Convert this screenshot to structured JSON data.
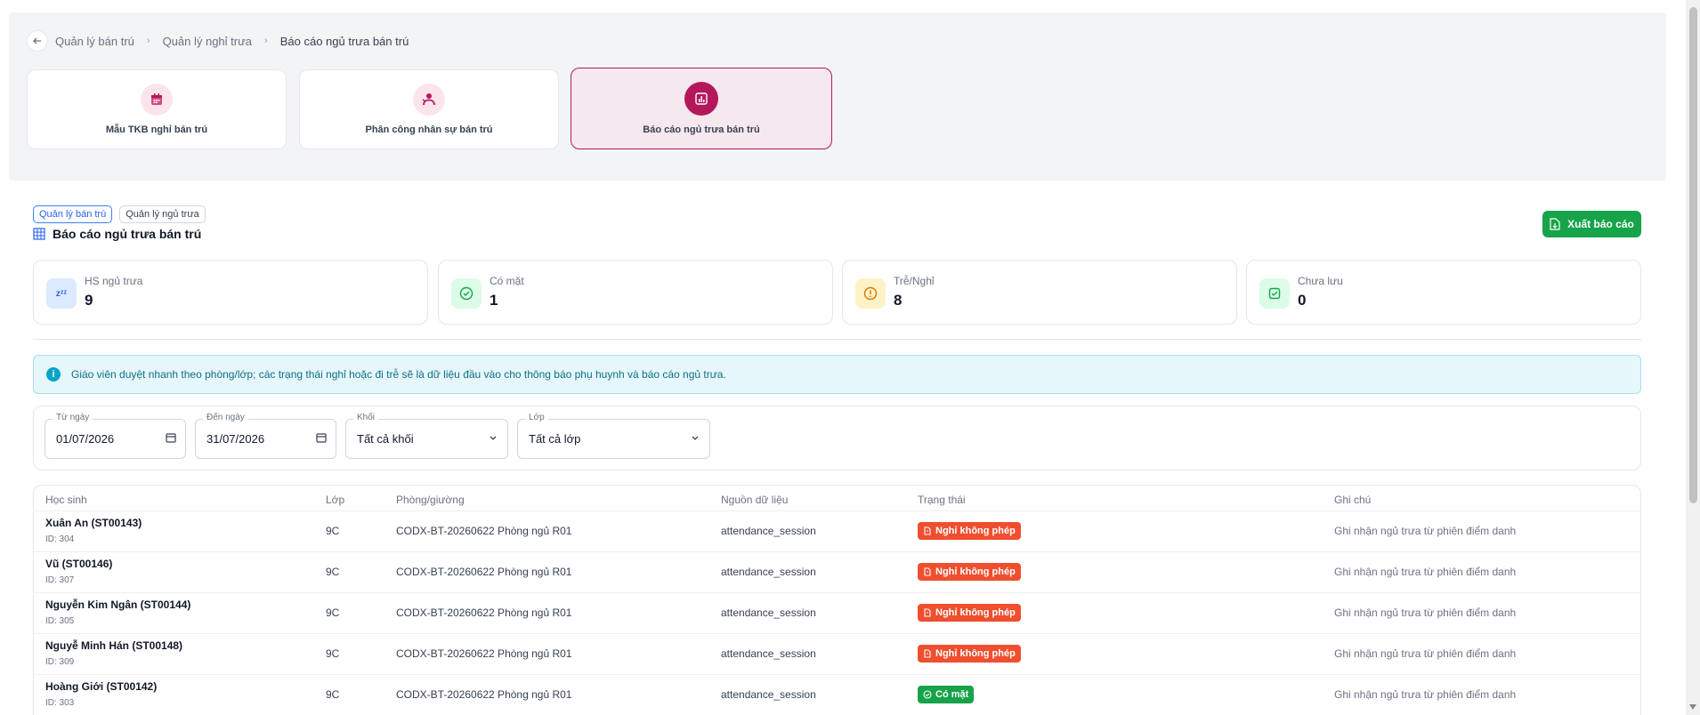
{
  "breadcrumb": {
    "items": [
      "Quản lý bán trú",
      "Quản lý nghỉ trưa",
      "Báo cáo ngủ trưa bán trú"
    ]
  },
  "nav_cards": [
    {
      "label": "Mẫu TKB nghỉ bán trú",
      "icon": "calendar-icon"
    },
    {
      "label": "Phân công nhân sự bán trú",
      "icon": "staff-assign-icon"
    },
    {
      "label": "Báo cáo ngủ trưa bán trú",
      "icon": "report-chart-icon",
      "active": true
    }
  ],
  "header": {
    "tags": [
      "Quản lý bán trú",
      "Quản lý ngủ trưa"
    ],
    "title": "Báo cáo ngủ trưa bán trú",
    "export_label": "Xuất báo cáo"
  },
  "stats": [
    {
      "label": "HS ngủ trưa",
      "value": "9",
      "icon": "sleep-zzz-icon"
    },
    {
      "label": "Có mặt",
      "value": "1",
      "icon": "check-circle-icon"
    },
    {
      "label": "Trễ/Nghỉ",
      "value": "8",
      "icon": "warning-circle-icon"
    },
    {
      "label": "Chưa lưu",
      "value": "0",
      "icon": "unsaved-icon"
    }
  ],
  "info": {
    "text": "Giáo viên duyệt nhanh theo phòng/lớp; các trạng thái nghỉ hoặc đi trễ sẽ là dữ liệu đầu vào cho thông báo phụ huynh và báo cáo ngủ trưa."
  },
  "filters": {
    "from": {
      "label": "Từ ngày",
      "value": "01/07/2026"
    },
    "to": {
      "label": "Đến ngày",
      "value": "31/07/2026"
    },
    "grade": {
      "label": "Khối",
      "value": "Tất cả khối"
    },
    "class": {
      "label": "Lớp",
      "value": "Tất cả lớp"
    }
  },
  "table": {
    "columns": [
      "Học sinh",
      "Lớp",
      "Phòng/giường",
      "Nguồn dữ liệu",
      "Trạng thái",
      "Ghi chú"
    ],
    "rows": [
      {
        "name": "Xuân An (ST00143)",
        "id": "ID: 304",
        "class": "9C",
        "room": "CODX-BT-20260622 Phòng ngủ R01",
        "source": "attendance_session",
        "status": "Nghỉ không phép",
        "status_color": "#ef4f2f",
        "note": "Ghi nhận ngủ trưa từ phiên điểm danh"
      },
      {
        "name": "Vũ (ST00146)",
        "id": "ID: 307",
        "class": "9C",
        "room": "CODX-BT-20260622 Phòng ngủ R01",
        "source": "attendance_session",
        "status": "Nghỉ không phép",
        "status_color": "#ef4f2f",
        "note": "Ghi nhận ngủ trưa từ phiên điểm danh"
      },
      {
        "name": "Nguyễn Kim Ngân (ST00144)",
        "id": "ID: 305",
        "class": "9C",
        "room": "CODX-BT-20260622 Phòng ngủ R01",
        "source": "attendance_session",
        "status": "Nghỉ không phép",
        "status_color": "#ef4f2f",
        "note": "Ghi nhận ngủ trưa từ phiên điểm danh"
      },
      {
        "name": "Nguyễ Minh Hán (ST00148)",
        "id": "ID: 309",
        "class": "9C",
        "room": "CODX-BT-20260622 Phòng ngủ R01",
        "source": "attendance_session",
        "status": "Nghỉ không phép",
        "status_color": "#ef4f2f",
        "note": "Ghi nhận ngủ trưa từ phiên điểm danh"
      },
      {
        "name": "Hoàng Giới (ST00142)",
        "id": "ID: 303",
        "class": "9C",
        "room": "CODX-BT-20260622 Phòng ngủ R01",
        "source": "attendance_session",
        "status": "Có mặt",
        "status_color": "#16a34a",
        "note": "Ghi nhận ngủ trưa từ phiên điểm danh"
      }
    ]
  }
}
